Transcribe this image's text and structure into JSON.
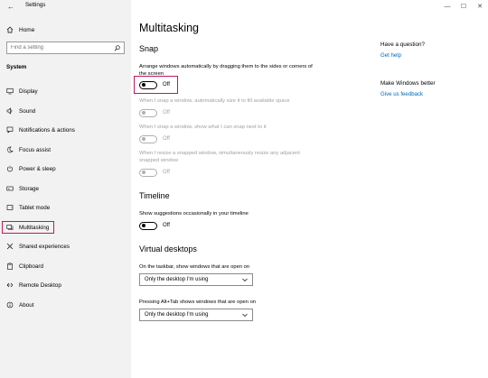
{
  "window": {
    "title": "Settings",
    "back_glyph": "←",
    "min_glyph": "—",
    "max_glyph": "☐",
    "close_glyph": "✕"
  },
  "sidebar": {
    "home_label": "Home",
    "search_placeholder": "Find a setting",
    "section": "System",
    "items": [
      {
        "label": "Display",
        "icon": "monitor-icon"
      },
      {
        "label": "Sound",
        "icon": "speaker-icon"
      },
      {
        "label": "Notifications & actions",
        "icon": "notification-icon"
      },
      {
        "label": "Focus assist",
        "icon": "moon-icon"
      },
      {
        "label": "Power & sleep",
        "icon": "power-icon"
      },
      {
        "label": "Storage",
        "icon": "storage-icon"
      },
      {
        "label": "Tablet mode",
        "icon": "tablet-icon"
      },
      {
        "label": "Multitasking",
        "icon": "multitasking-icon",
        "selected": true
      },
      {
        "label": "Shared experiences",
        "icon": "shared-icon"
      },
      {
        "label": "Clipboard",
        "icon": "clipboard-icon"
      },
      {
        "label": "Remote Desktop",
        "icon": "remote-icon"
      },
      {
        "label": "About",
        "icon": "info-icon"
      }
    ]
  },
  "main": {
    "title": "Multitasking",
    "snap": {
      "heading": "Snap",
      "arrange_desc": "Arrange windows automatically by dragging them to the sides or corners of the screen",
      "arrange_state": "Off",
      "fill_desc": "When I snap a window, automatically size it to fill available space",
      "fill_state": "Off",
      "show_desc": "When I snap a window, show what I can snap next to it",
      "show_state": "Off",
      "resize_desc": "When I resize a snapped window, simultaneously resize any adjacent snapped window",
      "resize_state": "Off"
    },
    "timeline": {
      "heading": "Timeline",
      "desc": "Show suggestions occasionally in your timeline",
      "state": "Off"
    },
    "virtual_desktops": {
      "heading": "Virtual desktops",
      "taskbar_label": "On the taskbar, show windows that are open on",
      "taskbar_value": "Only the desktop I'm using",
      "alttab_label": "Pressing Alt+Tab shows windows that are open on",
      "alttab_value": "Only the desktop I'm using"
    }
  },
  "aside": {
    "question_heading": "Have a question?",
    "get_help": "Get help",
    "better_heading": "Make Windows better",
    "feedback": "Give us feedback"
  },
  "colors": {
    "accent_link": "#0067b8",
    "highlight": "#c2185b",
    "sidebar_bg": "#f2f2f2"
  }
}
